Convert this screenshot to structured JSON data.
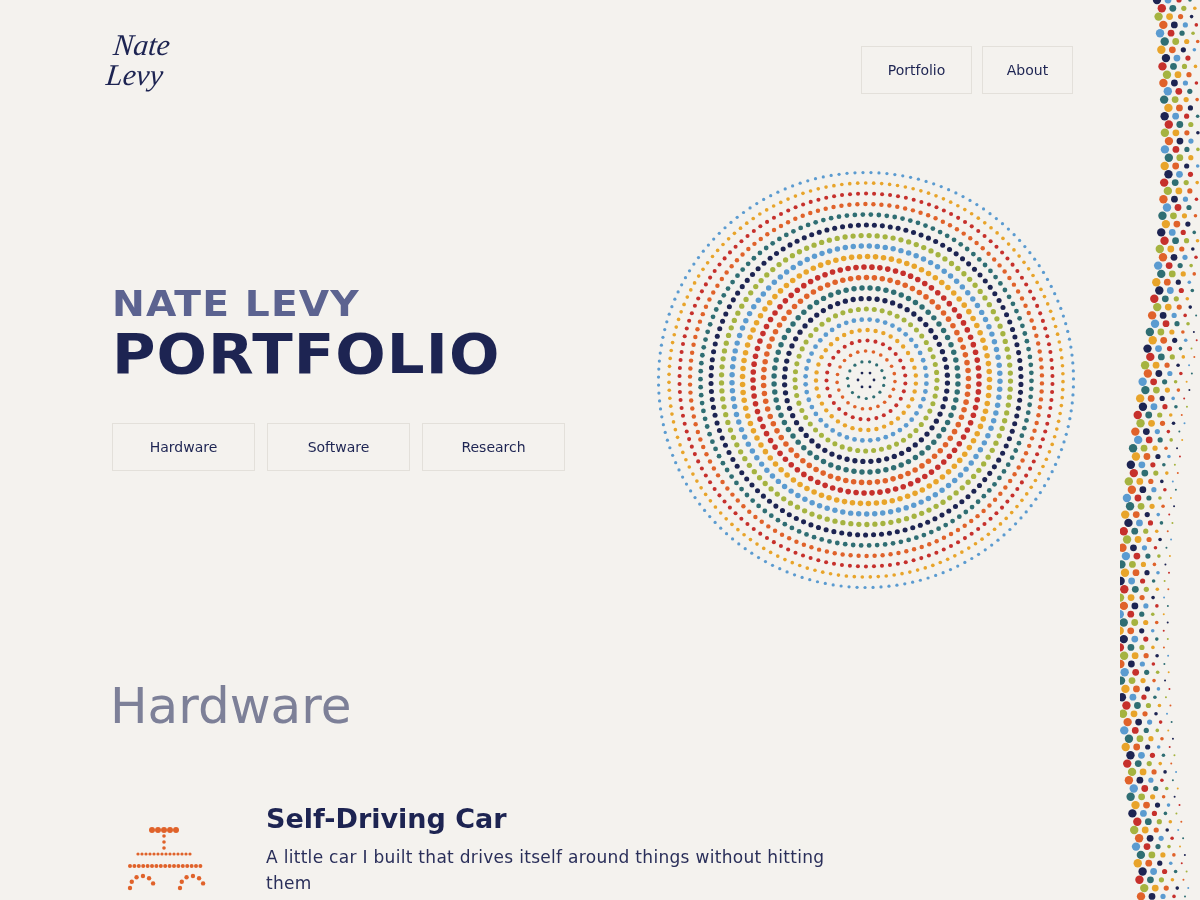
{
  "logo": {
    "lines": [
      "Nate",
      "Levy"
    ]
  },
  "nav": [
    {
      "label": "Portfolio"
    },
    {
      "label": "About"
    }
  ],
  "hero": {
    "subtitle": "NATE LEVY",
    "title": "PORTFOLIO",
    "categories": [
      {
        "label": "Hardware"
      },
      {
        "label": "Software"
      },
      {
        "label": "Research"
      }
    ]
  },
  "section": {
    "heading": "Hardware",
    "projects": [
      {
        "title": "Self-Driving Car",
        "description": "A little car I built that drives itself around things without hitting them"
      }
    ]
  }
}
